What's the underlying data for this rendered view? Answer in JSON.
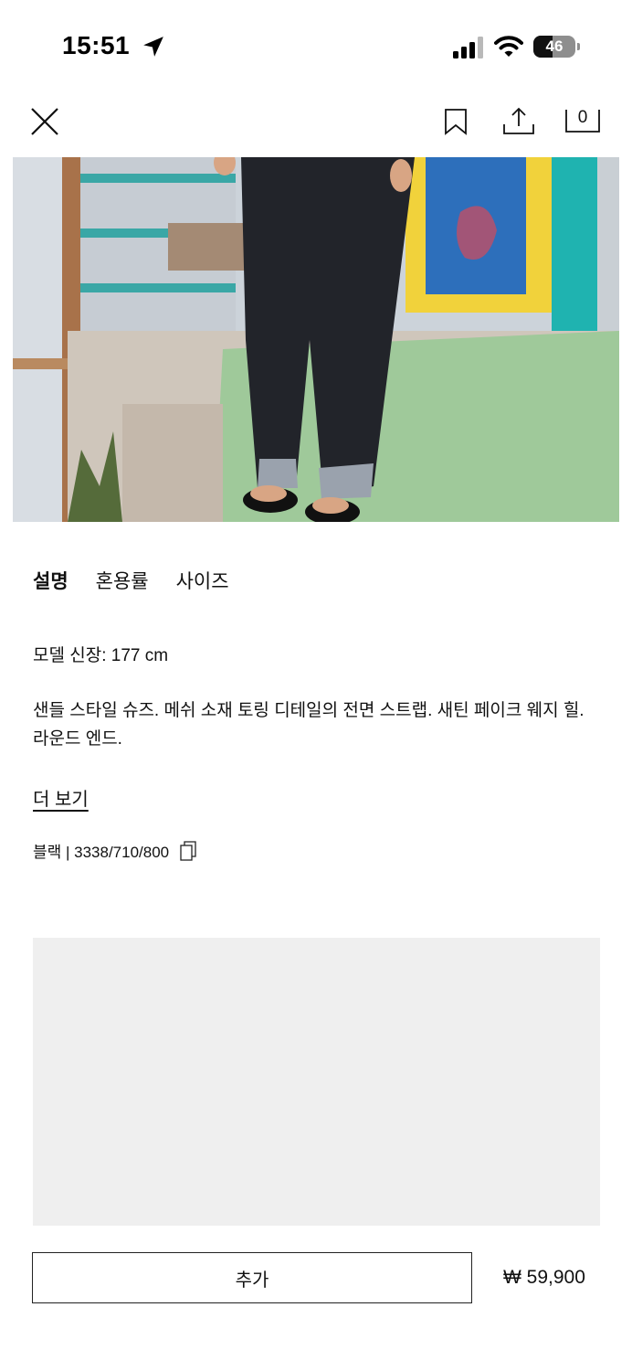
{
  "status_bar": {
    "time": "15:51",
    "battery_level": "46",
    "battery_fraction": 0.46,
    "icons": [
      "location-arrow-icon",
      "cellular-signal-icon",
      "wifi-icon",
      "battery-icon"
    ]
  },
  "nav": {
    "icons": [
      "close-icon",
      "bookmark-icon",
      "share-icon",
      "shopping-bag-icon"
    ],
    "cart_count": "0"
  },
  "tabs": [
    {
      "label": "설명",
      "active": true
    },
    {
      "label": "혼용률",
      "active": false
    },
    {
      "label": "사이즈",
      "active": false
    }
  ],
  "product": {
    "model_height": "모델 신장: 177 cm",
    "description": "샌들 스타일 슈즈. 메쉬 소재 토링 디테일의 전면 스트랩. 새틴 페이크 웨지 힐. 라운드 엔드.",
    "more_label": "더 보기",
    "color_ref": "블랙 | 3338/710/800",
    "add_label": "추가",
    "price": "₩ 59,900"
  },
  "colors": {
    "text": "#111111",
    "placeholder": "#efefef",
    "border": "#222222"
  }
}
